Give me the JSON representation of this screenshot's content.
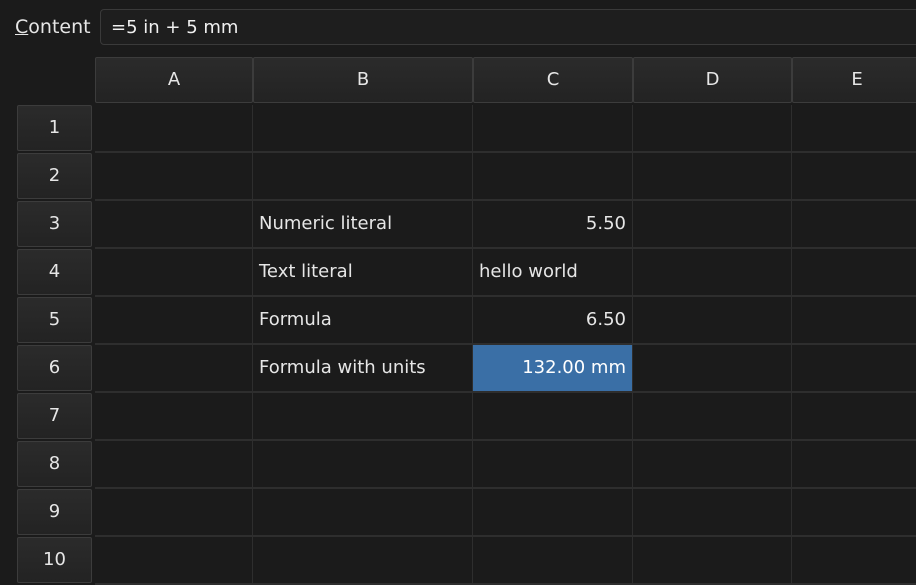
{
  "content_bar": {
    "label_mnemonic": "C",
    "label_rest": "ontent",
    "value": "=5 in + 5 mm"
  },
  "columns": [
    "A",
    "B",
    "C",
    "D",
    "E"
  ],
  "rows": [
    "1",
    "2",
    "3",
    "4",
    "5",
    "6",
    "7",
    "8",
    "9",
    "10"
  ],
  "cells": {
    "B3": "Numeric literal",
    "C3": "5.50",
    "B4": "Text literal",
    "C4": "hello world",
    "B5": "Formula",
    "C5": "6.50",
    "B6": "Formula with units",
    "C6": "132.00 mm"
  },
  "selected_cell": "C6",
  "colors": {
    "background": "#1b1b1b",
    "selection": "#3a6fa6",
    "gridline": "#2e2e2e"
  }
}
